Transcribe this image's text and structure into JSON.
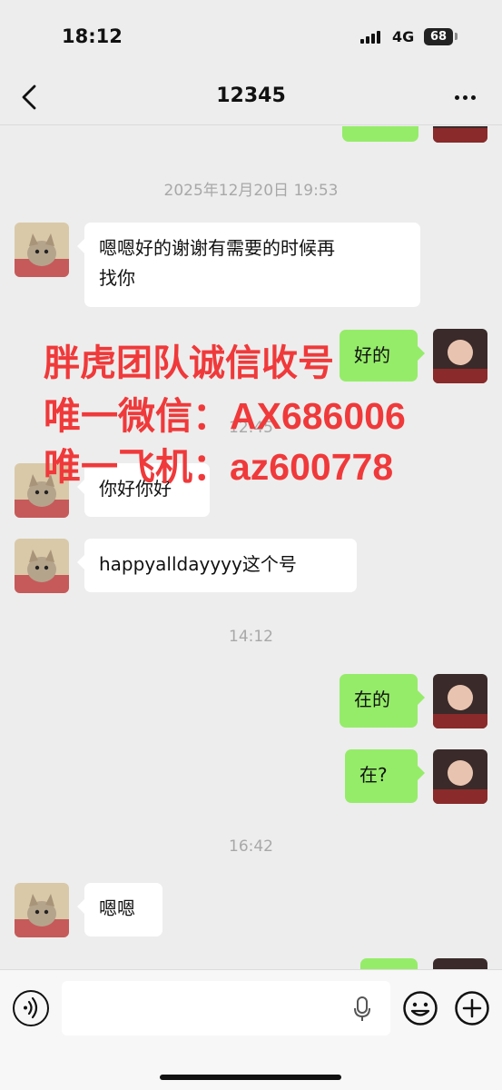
{
  "status_bar": {
    "time": "18:12",
    "network": "4G",
    "battery": "68"
  },
  "nav": {
    "title": "12345",
    "back_icon": "chevron-left-icon",
    "more_icon": "more-dots-icon"
  },
  "messages": [
    {
      "type": "timestamp",
      "text": "2025年12月20日 19:53"
    },
    {
      "type": "incoming",
      "sender_avatar": "kitten-avatar",
      "line1": "嗯嗯好的谢谢有需要的时候再",
      "line2": "找你"
    },
    {
      "type": "outgoing",
      "sender_avatar": "girl-avatar",
      "text": "好的"
    },
    {
      "type": "timestamp",
      "text": "12:45"
    },
    {
      "type": "incoming",
      "sender_avatar": "kitten-avatar",
      "text": "你好你好"
    },
    {
      "type": "incoming",
      "sender_avatar": "kitten-avatar",
      "text": "happyalldayyyy这个号"
    },
    {
      "type": "timestamp",
      "text": "14:12"
    },
    {
      "type": "outgoing",
      "sender_avatar": "girl-avatar",
      "text": "在的"
    },
    {
      "type": "outgoing",
      "sender_avatar": "girl-avatar",
      "text": "在?"
    },
    {
      "type": "timestamp",
      "text": "16:42"
    },
    {
      "type": "incoming",
      "sender_avatar": "kitten-avatar",
      "text": "嗯嗯"
    }
  ],
  "overlay": {
    "line1": "胖虎团队诚信收号",
    "line2": "唯一微信：AX686006",
    "line3": "唯一飞机：az600778",
    "color": "#f0393a"
  },
  "input_bar": {
    "voice_icon": "voice-icon",
    "mic_icon": "microphone-icon",
    "emoji_icon": "emoji-icon",
    "plus_icon": "plus-icon"
  },
  "colors": {
    "background": "#ededed",
    "outgoing_bubble": "#95ec69",
    "incoming_bubble": "#ffffff"
  }
}
